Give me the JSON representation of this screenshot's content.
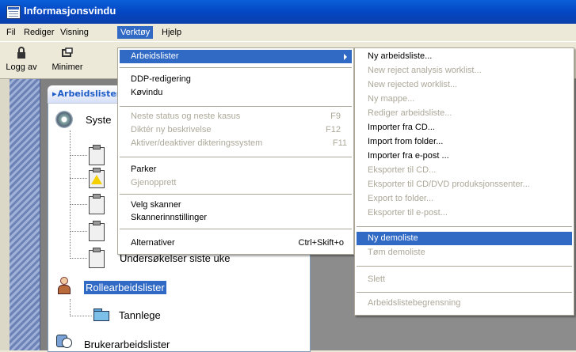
{
  "window": {
    "title": "Informasjonsvindu"
  },
  "menubar": {
    "items": [
      "Fil",
      "Rediger",
      "Visning",
      "Verktøy",
      "Hjelp"
    ]
  },
  "toolbar": {
    "logoff": "Logg av",
    "minimize": "Minimer"
  },
  "panel": {
    "header": "Arbeidslister"
  },
  "tree": {
    "system_label": "Syste",
    "survey_label": "Undersøkelser siste uke",
    "role_label": "Rollearbeidslister",
    "dentist_label": "Tannlege",
    "user_label": "Brukerarbeidslister"
  },
  "tools_menu": {
    "worklists": "Arbeidslister",
    "ddp": "DDP-redigering",
    "queue": "Køvindu",
    "next_status": "Neste status og neste kasus",
    "next_status_sc": "F9",
    "dictate": "Diktér ny beskrivelse",
    "dictate_sc": "F12",
    "toggle_dict": "Aktiver/deaktiver dikteringssystem",
    "toggle_dict_sc": "F11",
    "park": "Parker",
    "restore": "Gjenopprett",
    "select_scanner": "Velg skanner",
    "scanner_settings": "Skannerinnstillinger",
    "options": "Alternativer",
    "options_sc": "Ctrl+Skift+o"
  },
  "worklists_menu": {
    "new_worklist": "Ny arbeidsliste...",
    "new_reject": "New reject analysis worklist...",
    "new_rejected": "New rejected worklist...",
    "new_folder": "Ny mappe...",
    "edit_worklist": "Rediger arbeidsliste...",
    "import_cd": "Importer fra CD...",
    "import_folder": "Import from folder...",
    "import_email": "Importer fra e-post ...",
    "export_cd": "Eksporter til CD...",
    "export_cd_dvd": "Eksporter til CD/DVD produksjonssenter...",
    "export_folder": "Export to folder...",
    "export_email": "Eksporter til e-post...",
    "new_demo": "Ny demoliste",
    "empty_demo": "Tøm demoliste",
    "delete": "Slett",
    "limit": "Arbeidslistebegrensning"
  }
}
